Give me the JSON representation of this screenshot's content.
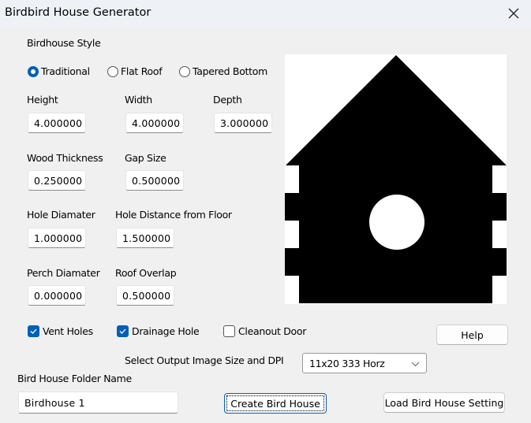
{
  "window": {
    "title": "Birdbird House Generator",
    "close_icon": "close-icon"
  },
  "style": {
    "label": "Birdhouse Style",
    "options": [
      {
        "label": "Traditional",
        "selected": true
      },
      {
        "label": "Flat Roof",
        "selected": false
      },
      {
        "label": "Tapered Bottom",
        "selected": false
      }
    ]
  },
  "fields": {
    "height": {
      "label": "Height",
      "value": "4.000000"
    },
    "width": {
      "label": "Width",
      "value": "4.000000"
    },
    "depth": {
      "label": "Depth",
      "value": "3.000000"
    },
    "wood_thickness": {
      "label": "Wood Thickness",
      "value": "0.250000"
    },
    "gap_size": {
      "label": "Gap Size",
      "value": "0.500000"
    },
    "hole_diameter": {
      "label": "Hole Diamater",
      "value": "1.000000"
    },
    "hole_distance": {
      "label": "Hole Distance from Floor",
      "value": "1.500000"
    },
    "perch_diameter": {
      "label": "Perch Diamater",
      "value": "0.000000"
    },
    "roof_overlap": {
      "label": "Roof Overlap",
      "value": "0.500000"
    }
  },
  "options": [
    {
      "label": "Vent Holes",
      "checked": true
    },
    {
      "label": "Drainage Hole",
      "checked": true
    },
    {
      "label": "Cleanout Door",
      "checked": false
    }
  ],
  "output": {
    "label": "Select Output Image Size and DPI",
    "selected": "11x20 333 Horz"
  },
  "folder": {
    "label": "Bird House Folder Name",
    "value": "Birdhouse 1"
  },
  "buttons": {
    "help": "Help",
    "create": "Create Bird House",
    "load": "Load Bird House Setting"
  },
  "colors": {
    "accent": "#005fb8",
    "preview_fill": "#000000",
    "preview_bg": "#ffffff"
  }
}
